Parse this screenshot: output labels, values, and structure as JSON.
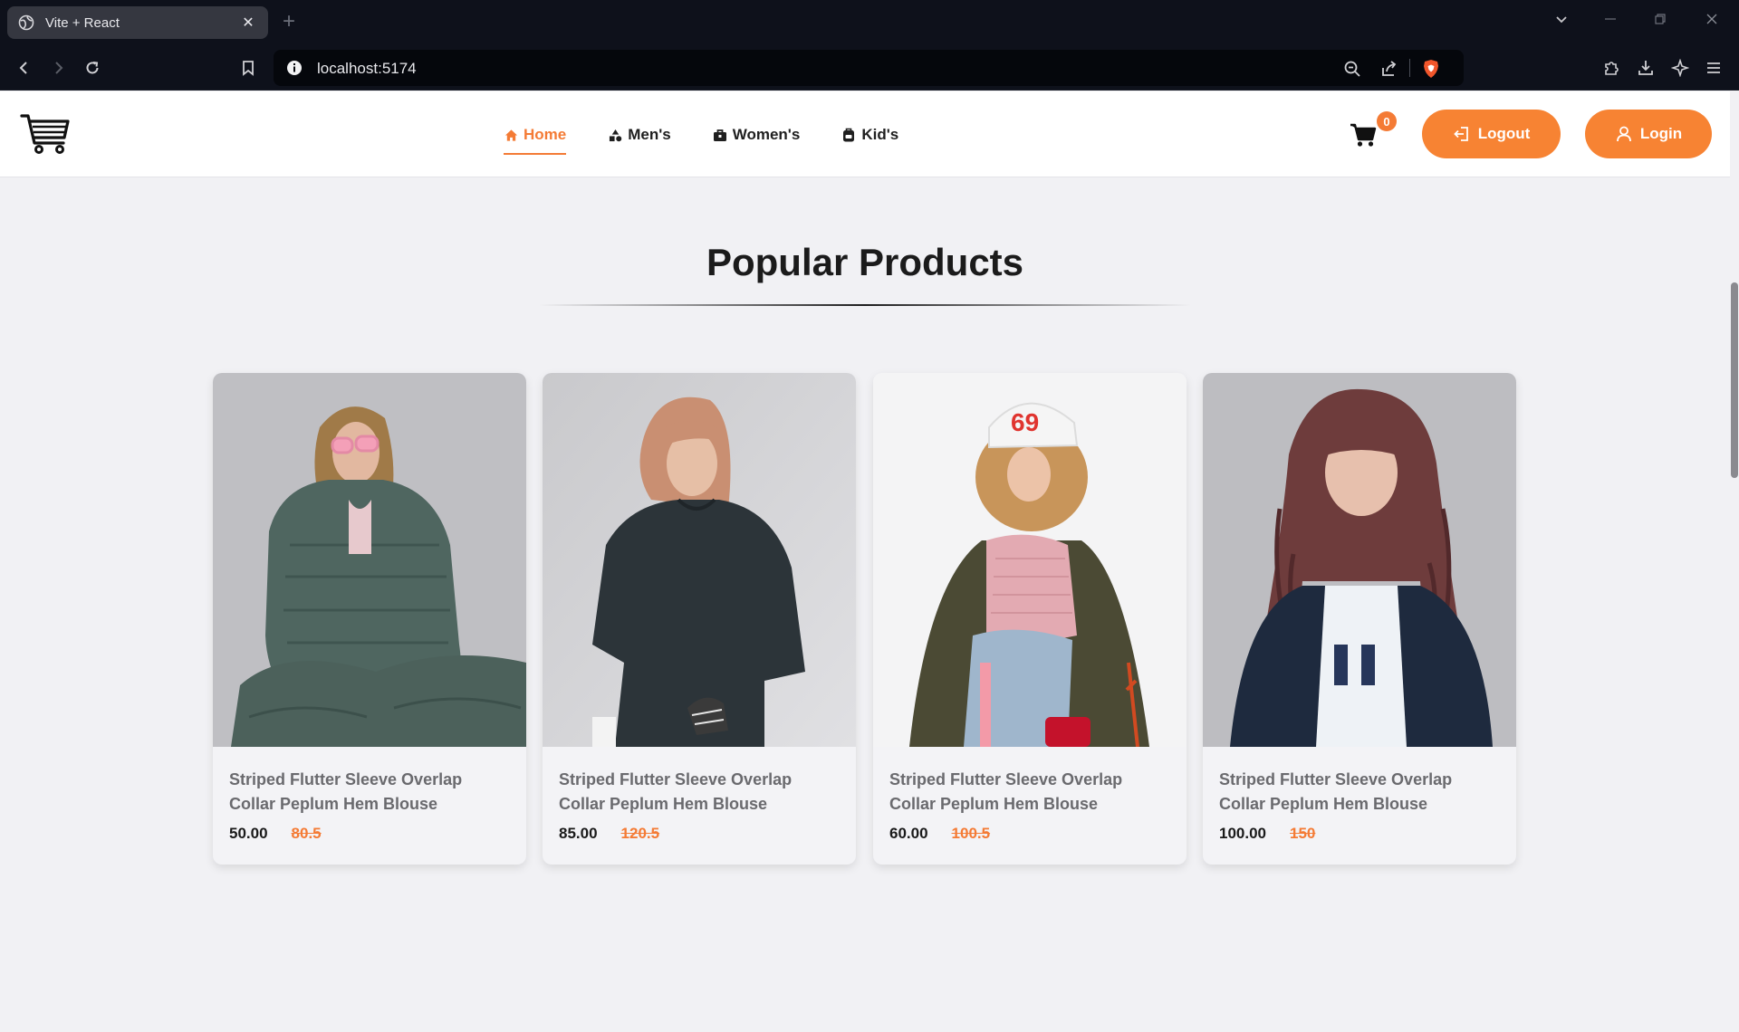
{
  "browser": {
    "tab_title": "Vite + React",
    "url": "localhost:5174"
  },
  "site": {
    "nav": [
      {
        "label": "Home",
        "icon": "home-icon",
        "active": true
      },
      {
        "label": "Men's",
        "icon": "shapes-icon",
        "active": false
      },
      {
        "label": "Women's",
        "icon": "briefcase-icon",
        "active": false
      },
      {
        "label": "Kid's",
        "icon": "backpack-icon",
        "active": false
      }
    ],
    "cart_count": "0",
    "logout_label": "Logout",
    "login_label": "Login",
    "accent_color": "#f47b35"
  },
  "main": {
    "section_title": "Popular Products",
    "products": [
      {
        "name": "Striped Flutter Sleeve Overlap Collar Peplum Hem Blouse",
        "price": "50.00",
        "old_price": "80.5"
      },
      {
        "name": "Striped Flutter Sleeve Overlap Collar Peplum Hem Blouse",
        "price": "85.00",
        "old_price": "120.5"
      },
      {
        "name": "Striped Flutter Sleeve Overlap Collar Peplum Hem Blouse",
        "price": "60.00",
        "old_price": "100.5"
      },
      {
        "name": "Striped Flutter Sleeve Overlap Collar Peplum Hem Blouse",
        "price": "100.00",
        "old_price": "150"
      }
    ]
  }
}
